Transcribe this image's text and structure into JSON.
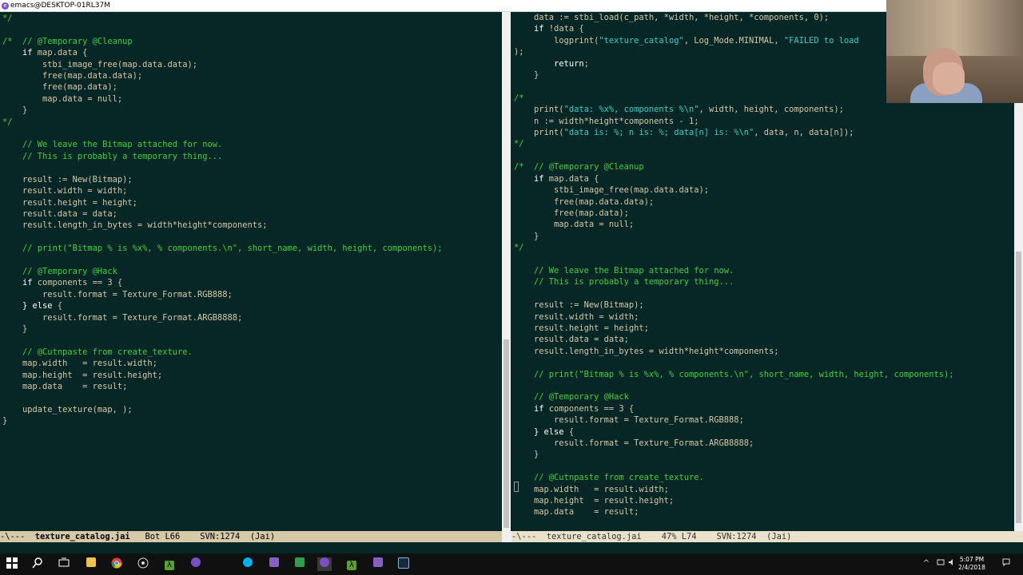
{
  "window": {
    "title": "emacs@DESKTOP-01RL37M"
  },
  "left_pane": {
    "code": "*/\n\n/*  // @Temporary @Cleanup\n    if map.data {\n        stbi_image_free(map.data.data);\n        free(map.data.data);\n        free(map.data);\n        map.data = null;\n    }\n*/\n\n    // We leave the Bitmap attached for now.\n    // This is probably a temporary thing...\n\n    result := New(Bitmap);\n    result.width = width;\n    result.height = height;\n    result.data = data;\n    result.length_in_bytes = width*height*components;\n\n    // print(\"Bitmap % is %x%, % components.\\n\", short_name, width, height, components);\n\n    // @Temporary @Hack\n    if components == 3 {\n        result.format = Texture_Format.RGB888;\n    } else {\n        result.format = Texture_Format.ARGB8888;\n    }\n\n    // @Cutnpaste from create_texture.\n    map.width   = result.width;\n    map.height  = result.height;\n    map.data    = result;\n\n    update_texture(map, );\n}",
    "modeline": {
      "prefix": "-\\---  ",
      "buffer": "texture_catalog.jai",
      "position": "Bot L66",
      "vcs": "SVN:1274",
      "mode": "(Jai)"
    }
  },
  "right_pane": {
    "code": "    data := stbi_load(c_path, *width, *height, *components, 0);\n    if !data {\n        logprint(\"texture_catalog\", Log_Mode.MINIMAL, \"FAILED to load\n);\n        return;\n    }\n\n/*\n    print(\"data: %x%, components %\\n\", width, height, components);\n    n := width*height*components - 1;\n    print(\"data is: %; n is: %; data[n] is: %\\n\", data, n, data[n]);\n*/\n\n/*  // @Temporary @Cleanup\n    if map.data {\n        stbi_image_free(map.data.data);\n        free(map.data.data);\n        free(map.data);\n        map.data = null;\n    }\n*/\n\n    // We leave the Bitmap attached for now.\n    // This is probably a temporary thing...\n\n    result := New(Bitmap);\n    result.width = width;\n    result.height = height;\n    result.data = data;\n    result.length_in_bytes = width*height*components;\n\n    // print(\"Bitmap % is %x%, % components.\\n\", short_name, width, height, components);\n\n    // @Temporary @Hack\n    if components == 3 {\n        result.format = Texture_Format.RGB888;\n    } else {\n        result.format = Texture_Format.ARGB8888;\n    }\n\n    // @Cutnpaste from create_texture.\n    map.width   = result.width;\n    map.height  = result.height;\n    map.data    = result;",
    "modeline": {
      "prefix": "-\\---  ",
      "buffer": "texture_catalog.jai",
      "position": "47% L74",
      "vcs": "SVN:1274",
      "mode": "(Jai)"
    }
  },
  "taskbar": {
    "time": "5:07 PM",
    "date": "2/4/2018",
    "icons": [
      "windows-start",
      "search",
      "task-view",
      "file-explorer",
      "chrome",
      "generic-app",
      "jai-app",
      "emacs-app",
      "skype",
      "visual-studio",
      "green-app",
      "emacs-active",
      "lambda-app",
      "visual-studio-2",
      "steam"
    ]
  },
  "colors": {
    "background": "#072626",
    "text": "#d6c9a8",
    "comment": "#3fd13f",
    "string": "#2fd1c8",
    "modeline": "#d6c9a8"
  }
}
